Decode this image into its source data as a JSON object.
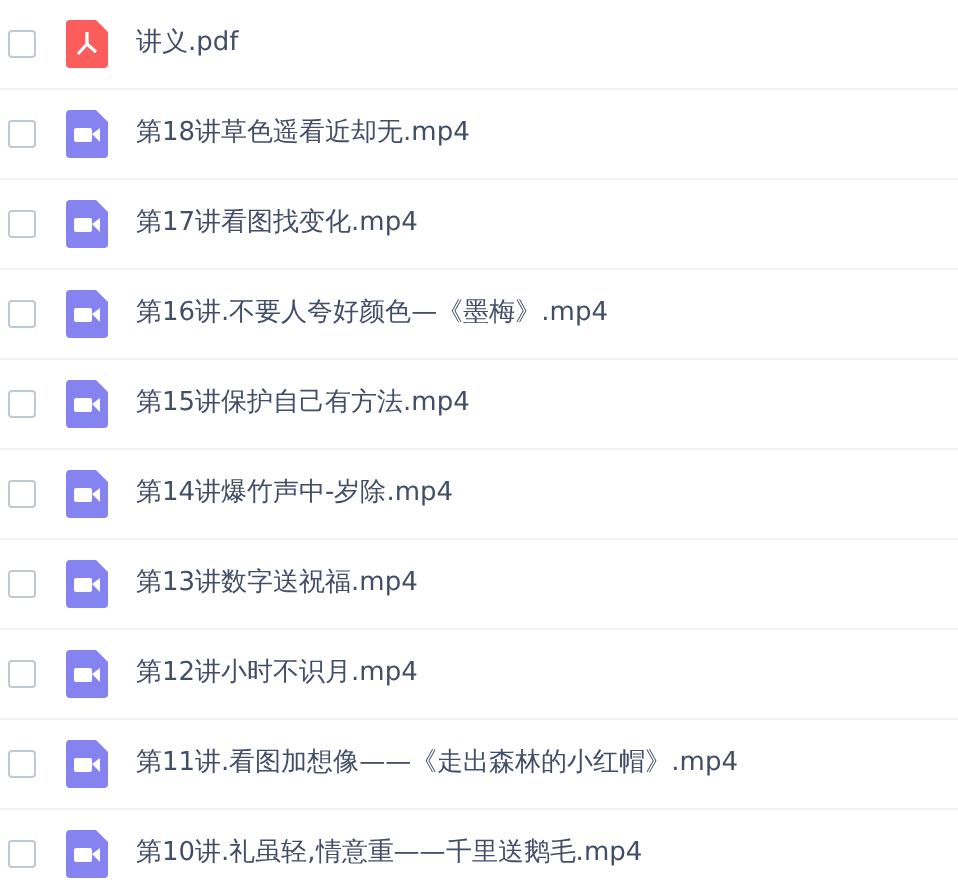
{
  "files": [
    {
      "kind": "pdf",
      "name": "讲义.pdf",
      "checked": false
    },
    {
      "kind": "video",
      "name": "第18讲草色遥看近却无.mp4",
      "checked": false
    },
    {
      "kind": "video",
      "name": "第17讲看图找变化.mp4",
      "checked": false
    },
    {
      "kind": "video",
      "name": "第16讲.不要人夸好颜色—《墨梅》.mp4",
      "checked": false
    },
    {
      "kind": "video",
      "name": "第15讲保护自己有方法.mp4",
      "checked": false
    },
    {
      "kind": "video",
      "name": "第14讲爆竹声中-岁除.mp4",
      "checked": false
    },
    {
      "kind": "video",
      "name": "第13讲数字送祝福.mp4",
      "checked": false
    },
    {
      "kind": "video",
      "name": "第12讲小时不识月.mp4",
      "checked": false
    },
    {
      "kind": "video",
      "name": "第11讲.看图加想像——《走出森林的小红帽》.mp4",
      "checked": false
    },
    {
      "kind": "video",
      "name": "第10讲.礼虽轻,情意重——千里送鹅毛.mp4",
      "checked": false
    }
  ]
}
